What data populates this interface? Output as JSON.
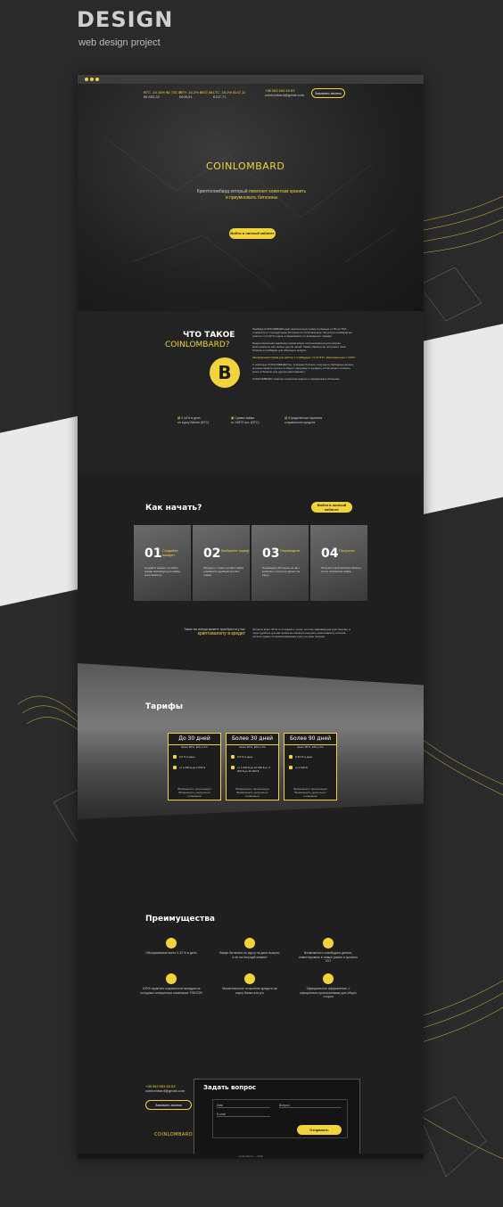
{
  "brand": {
    "title": "DESIGN",
    "subtitle": "web design project"
  },
  "topbar": {
    "rates": [
      {
        "label": "BTC -10.16% $6 730,70",
        "sub": "€6 553,32"
      },
      {
        "label": "ETH -10.2% $637,68",
        "sub": "€608,01"
      },
      {
        "label": "LTC -10.2% $147,11",
        "sub": "€107,71"
      }
    ],
    "phone": "+38 063 063 63 63",
    "email": "coinlombard@gmail.com",
    "call_button": "Заказать звонок"
  },
  "hero": {
    "logo": "COINLOMBARD",
    "tagline_1": "Криптоломбард который",
    "tagline_highlight": "помогает клиентам хранить",
    "tagline_2": "и приумножать биткоины",
    "cta": "Войти в личный кабинет"
  },
  "about": {
    "title_1": "ЧТО ТАКОЕ",
    "title_2": "COINLOMBARD?",
    "coin_symbol": "B",
    "para_1": "Ломбард COINLOMBARD даёт аналогичную сумму в размере от 50 до 70% стоимости от текущей цены биткоина по Coinmarketcap. За услуги ломбарда вы платите от 0,33 % в день в зависимости от выбранного тарифа.",
    "para_2": "Предоставленная заёмщику сумма может использоваться для покупки криптовалюты или любых других целей. Также обратно вы получаете свой биткоин в ломбарде для обратного выкупа.",
    "para_3": "Минимальная сумма для работы с ломбардом = 0,01 BTC. Максимальная = 3 BTC",
    "para_4": "С помощью COINLOMBARD вы, сохраняя биткоин, получаете свободные деньги, которые можете пустить в оборот, например в трейдинг, в ICO проект, вложить опять в биткоин или другую криптовалюту.",
    "para_5": "COINLOMBARD помогает клиентам хранить и приумножать биткоины.",
    "stats": [
      {
        "text": "0,44% в день",
        "sub": "по курсу Bitcoin (BTC)"
      },
      {
        "text": "Сумма займа",
        "sub": "от 29870 грн. (BTC)"
      },
      {
        "text": "Юридическая гарантия",
        "sub": "сохранности средств"
      }
    ]
  },
  "howto": {
    "title": "Как начать?",
    "cta": "Войти в личный кабинет",
    "steps": [
      {
        "num": "01",
        "label": "Создайте аккаунт",
        "text": "Создайте аккаунт на сайте, указав желаемую для займа криптовалюту."
      },
      {
        "num": "02",
        "label": "Выберите тариф",
        "text": "Обсудите с нами условия займа и выберите удобный для вас тариф."
      },
      {
        "num": "03",
        "label": "Переведите",
        "text": "Переведите биткоины на наш кошелёк и получите деньги на карту."
      },
      {
        "num": "04",
        "label": "Получите",
        "text": "Получите свой биткоин обратно после погашения займа."
      }
    ],
    "credit_left_1": "Также вы всегда можете приобрести у нас",
    "credit_left_2": "криптовалюту в кредит",
    "credit_right": "Оплатив всего 30 % от стоимости, после чего мы зафиксируем курс покупки, а через удобное для вас время вы сможете выкупить криптовалюту оплатив остаток суммы по фиксированному курсу на день покупки."
  },
  "tariffs": {
    "title": "Тарифы",
    "items": [
      {
        "name": "До 30 дней",
        "sub": "Залог BTC, ETH, LTC",
        "rate": "0,5 % в день",
        "range": "от 1 000 $ до 2 000 $",
        "note": "Возможность пролонгации Возможность досрочного погашения"
      },
      {
        "name": "Более 30 дней",
        "sub": "Залог BTC, ETH, LTC",
        "rate": "0,5 % в день",
        "range": "от 1 000 $ до 10 000 $ от 2 000 $ до 20 000 $",
        "note": "Возможность пролонгации Возможность досрочного погашения"
      },
      {
        "name": "Более 90 дней",
        "sub": "Залог BTC, ETH, LTC",
        "rate": "0,33 % в день",
        "range": "от 2 000 $",
        "note": "Возможность пролонгации Возможность досрочного погашения"
      }
    ]
  },
  "advantages": {
    "title": "Преимущества",
    "items": [
      {
        "text": "Обслуживание всего 0,33 % в день"
      },
      {
        "text": "Выкуп биткоина по курсу на день выкупа, а не на текущий момент"
      },
      {
        "text": "Возможность освободить деньги, инвестировать в новые рынки и проекты ICO"
      },
      {
        "text": "100% гарантия сохранности вкладов на холодных аппаратных кошельках TREZOR"
      },
      {
        "text": "Моментальное получение кредита на карту банка или р/с"
      },
      {
        "text": "Официальное оформление, с официально прописанными для общих сторон"
      }
    ]
  },
  "contact": {
    "phone": "+38 063 063 63 63",
    "email": "coinlombard@gmail.com",
    "call_button": "Заказать звонок",
    "form_title": "Задать вопрос",
    "name_label": "Имя",
    "question_label": "Вопрос",
    "email_label": "E-mail",
    "submit": "Отправить",
    "logo": "COINLOMBARD",
    "copyright": "coinlombard — 2018"
  }
}
